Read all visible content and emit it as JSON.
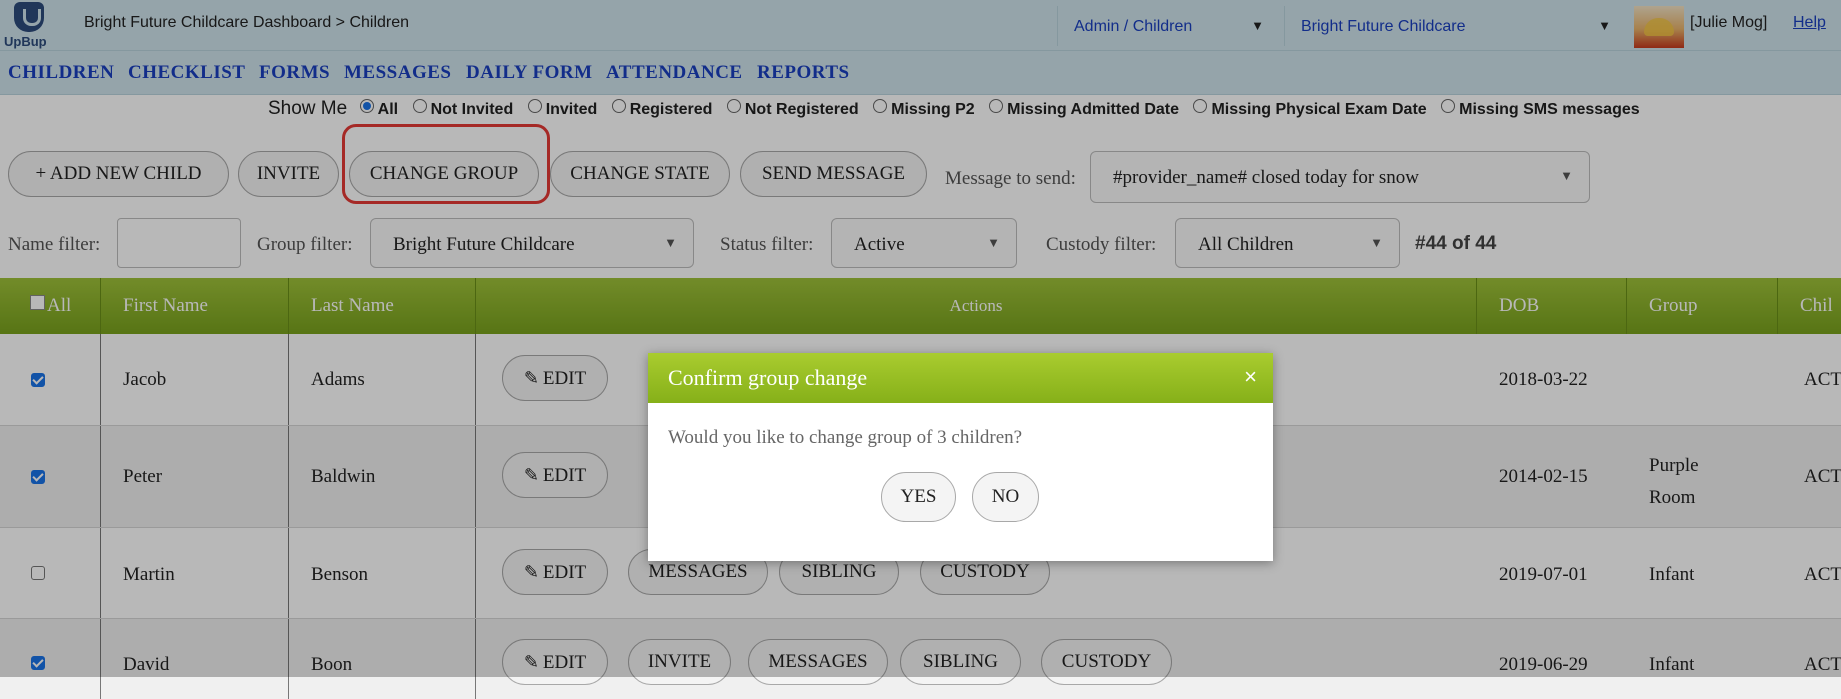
{
  "header": {
    "logo_text": "UpBup",
    "breadcrumb": "Bright Future Childcare Dashboard > Children",
    "role_select": "Admin / Children",
    "provider_select": "Bright Future Childcare",
    "user": "[Julie Mog]",
    "help": "Help"
  },
  "nav": [
    "CHILDREN",
    "CHECKLIST",
    "FORMS",
    "MESSAGES",
    "DAILY FORM",
    "ATTENDANCE",
    "REPORTS"
  ],
  "show_me": {
    "label": "Show Me",
    "selected": "All",
    "options": [
      "All",
      "Not Invited",
      "Invited",
      "Registered",
      "Not Registered",
      "Missing P2",
      "Missing Admitted Date",
      "Missing Physical Exam Date",
      "Missing SMS messages"
    ]
  },
  "toolbar": {
    "add_new_child": "+ ADD NEW CHILD",
    "invite": "INVITE",
    "change_group": "CHANGE GROUP",
    "change_state": "CHANGE STATE",
    "send_message": "SEND MESSAGE",
    "message_label": "Message to send:",
    "message_value": "#provider_name# closed today for snow"
  },
  "filters": {
    "name_label": "Name filter:",
    "name_value": "",
    "group_label": "Group filter:",
    "group_value": "Bright Future Childcare",
    "status_label": "Status filter:",
    "status_value": "Active",
    "custody_label": "Custody filter:",
    "custody_value": "All Children",
    "count": "#44 of 44"
  },
  "table": {
    "columns": [
      "All",
      "First Name",
      "Last Name",
      "Actions",
      "DOB",
      "Group",
      "Chil"
    ],
    "rows": [
      {
        "checked": true,
        "first": "Jacob",
        "last": "Adams",
        "actions": [
          "EDIT"
        ],
        "dob": "2018-03-22",
        "group": "",
        "status": "ACT"
      },
      {
        "checked": true,
        "first": "Peter",
        "last": "Baldwin",
        "actions": [
          "EDIT"
        ],
        "dob": "2014-02-15",
        "group": "Purple Room",
        "status": "ACT"
      },
      {
        "checked": false,
        "first": "Martin",
        "last": "Benson",
        "actions": [
          "EDIT",
          "MESSAGES",
          "SIBLING",
          "CUSTODY"
        ],
        "dob": "2019-07-01",
        "group": "Infant",
        "status": "ACT"
      },
      {
        "checked": true,
        "first": "David",
        "last": "Boon",
        "actions": [
          "EDIT",
          "INVITE",
          "MESSAGES",
          "SIBLING",
          "CUSTODY"
        ],
        "dob": "2019-06-29",
        "group": "Infant",
        "status": "ACT"
      }
    ]
  },
  "modal": {
    "title": "Confirm group change",
    "close": "×",
    "body": "Would you like to change group of 3 children?",
    "yes": "YES",
    "no": "NO"
  },
  "colors": {
    "header_bg": "#cfe4ec",
    "link_blue": "#1a3fbf",
    "table_head_green": "#79a21d",
    "highlight_red": "#e53935"
  }
}
